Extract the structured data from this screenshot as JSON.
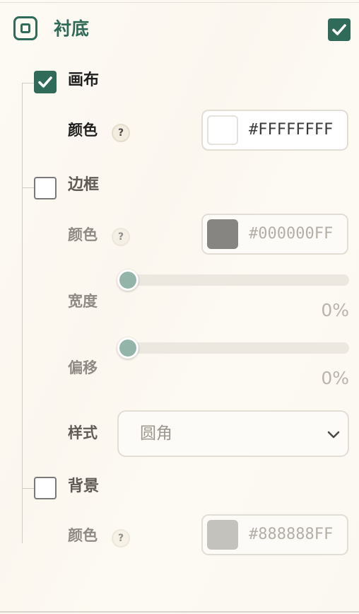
{
  "header": {
    "title": "衬底",
    "enabled": true
  },
  "canvas": {
    "label": "画布",
    "enabled": true,
    "color_label": "颜色",
    "color_value": "#FFFFFFFF",
    "swatch": "#ffffff"
  },
  "border": {
    "label": "边框",
    "enabled": false,
    "color_label": "颜色",
    "color_value": "#000000FF",
    "swatch": "#878582",
    "width_label": "宽度",
    "width_value": "0%",
    "offset_label": "偏移",
    "offset_value": "0%",
    "style_label": "样式",
    "style_value": "圆角"
  },
  "background": {
    "label": "背景",
    "enabled": false,
    "color_label": "颜色",
    "color_value": "#888888FF",
    "swatch": "#c4c2bd"
  },
  "help_symbol": "?",
  "colors": {
    "accent": "#2f6b58",
    "active_text": "#1f1f1f",
    "disabled_text": "#8f8b84",
    "disabled_value": "#b3afa7"
  }
}
